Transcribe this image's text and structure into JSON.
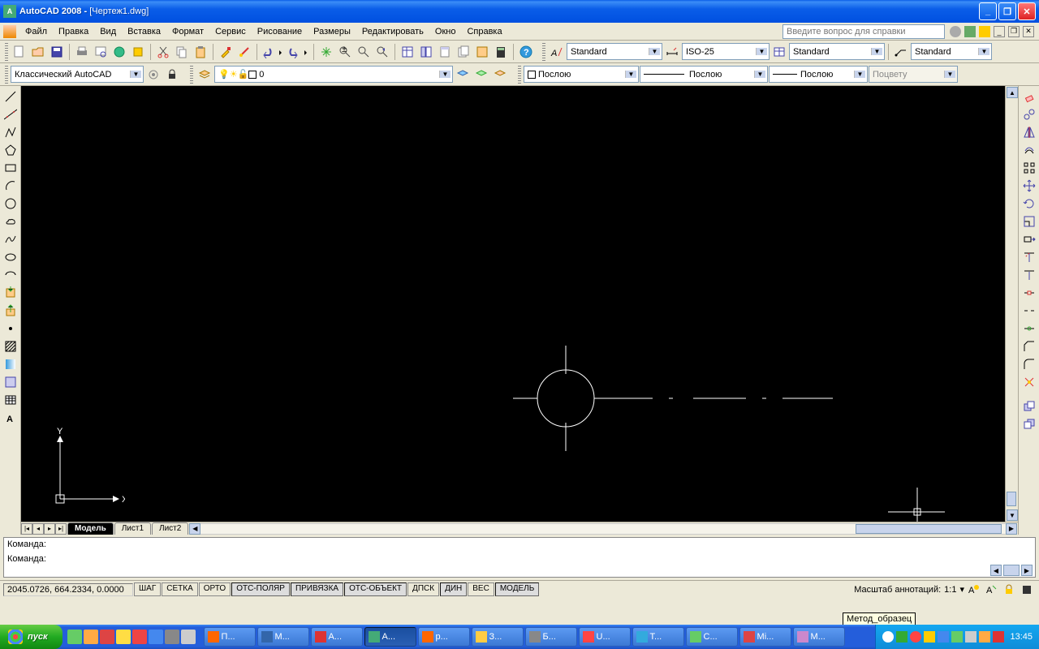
{
  "app": {
    "name": "AutoCAD 2008",
    "document": "[Чертеж1.dwg]"
  },
  "menu": [
    "Файл",
    "Правка",
    "Вид",
    "Вставка",
    "Формат",
    "Сервис",
    "Рисование",
    "Размеры",
    "Редактировать",
    "Окно",
    "Справка"
  ],
  "help_search_placeholder": "Введите вопрос для справки",
  "toolbar2": {
    "workspace": "Классический AutoCAD",
    "layer_current": "0",
    "text_style": "Standard",
    "dim_style": "ISO-25",
    "table_style": "Standard",
    "mleader_style": "Standard"
  },
  "toolbar3": {
    "color": "Послою",
    "linetype": "Послою",
    "lineweight": "Послою",
    "plotstyle": "Поцвету"
  },
  "tabs": {
    "nav": [
      "|◂",
      "◂",
      "▸",
      "▸|"
    ],
    "items": [
      "Модель",
      "Лист1",
      "Лист2"
    ],
    "active": 0
  },
  "command": {
    "prompt": "Команда:"
  },
  "status": {
    "coords": "2045.0726, 664.2334, 0.0000",
    "toggles": [
      "ШАГ",
      "СЕТКА",
      "ОРТО",
      "ОТС-ПОЛЯР",
      "ПРИВЯЗКА",
      "ОТС-ОБЪЕКТ",
      "ДПСК",
      "ДИН",
      "ВЕС",
      "МОДЕЛЬ"
    ],
    "pressed": [
      3,
      4,
      5,
      7,
      9
    ],
    "anno_scale_label": "Масштаб аннотаций:",
    "anno_scale_value": "1:1"
  },
  "tooltip": "Метод_образец",
  "taskbar": {
    "start": "пуск",
    "buttons": [
      "П...",
      "М...",
      "A...",
      "A...",
      "р...",
      "З...",
      "Б...",
      "U...",
      "Т...",
      "С...",
      "Mi...",
      "М..."
    ],
    "active_index": 3,
    "clock": "13:45"
  },
  "ucs_labels": {
    "x": "X",
    "y": "Y"
  }
}
